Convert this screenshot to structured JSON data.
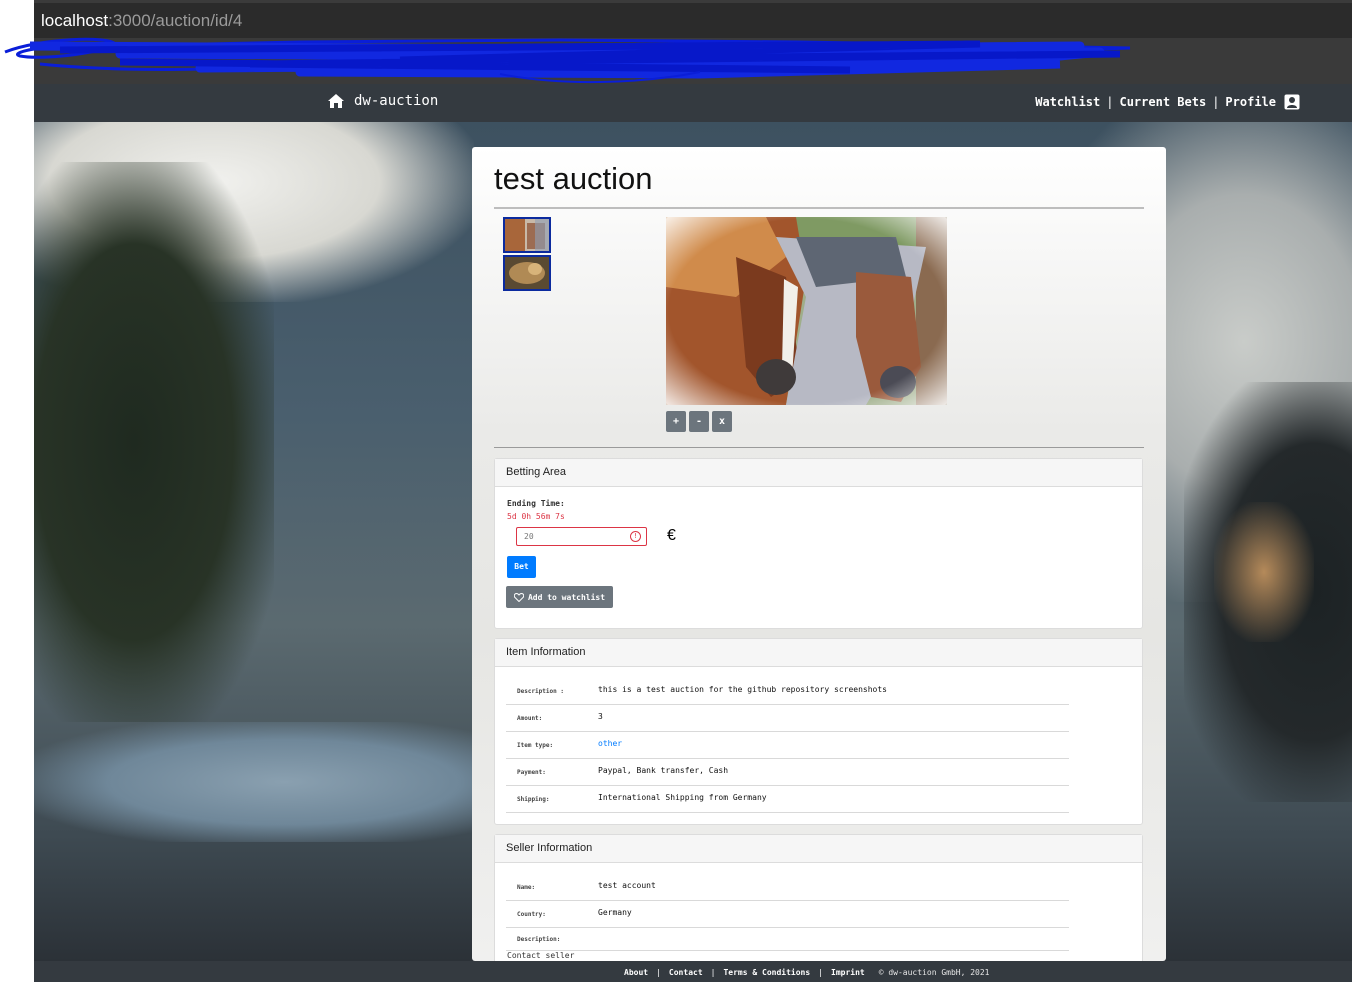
{
  "browser": {
    "url_host": "localhost",
    "url_path": ":3000/auction/id/4"
  },
  "navbar": {
    "brand": "dw-auction",
    "links": {
      "watchlist": "Watchlist",
      "current_bets": "Current Bets",
      "profile": "Profile"
    },
    "separator": "|"
  },
  "auction": {
    "title": "test auction",
    "zoom_buttons": {
      "plus": "+",
      "minus": "-",
      "close": "x"
    }
  },
  "betting": {
    "header": "Betting Area",
    "ending_label": "Ending Time:",
    "countdown": "5d 0h 56m 7s",
    "bet_value": "20",
    "currency": "€",
    "bet_button": "Bet",
    "watchlist_button": "Add to watchlist"
  },
  "item": {
    "header": "Item Information",
    "rows": [
      {
        "key": "Description :",
        "value": "this is a test auction for the github repository screenshots"
      },
      {
        "key": "Amount:",
        "value": "3"
      },
      {
        "key": "Item type:",
        "value": "other"
      },
      {
        "key": "Payment:",
        "value": "Paypal, Bank transfer, Cash"
      },
      {
        "key": "Shipping:",
        "value": "International Shipping from Germany"
      }
    ]
  },
  "seller": {
    "header": "Seller Information",
    "rows": [
      {
        "key": "Name:",
        "value": "test account"
      },
      {
        "key": "Country:",
        "value": "Germany"
      },
      {
        "key": "Description:",
        "value": ""
      }
    ],
    "contact": "Contact seller"
  },
  "footer": {
    "about": "About",
    "contact": "Contact",
    "terms": "Terms & Conditions",
    "imprint": "Imprint",
    "copyright": "© dw-auction GmbH, 2021",
    "separator": "|"
  },
  "colors": {
    "navbar": "#343a40",
    "primary": "#007bff",
    "secondary": "#6c757d",
    "danger": "#dc3545",
    "link": "#007bff"
  }
}
